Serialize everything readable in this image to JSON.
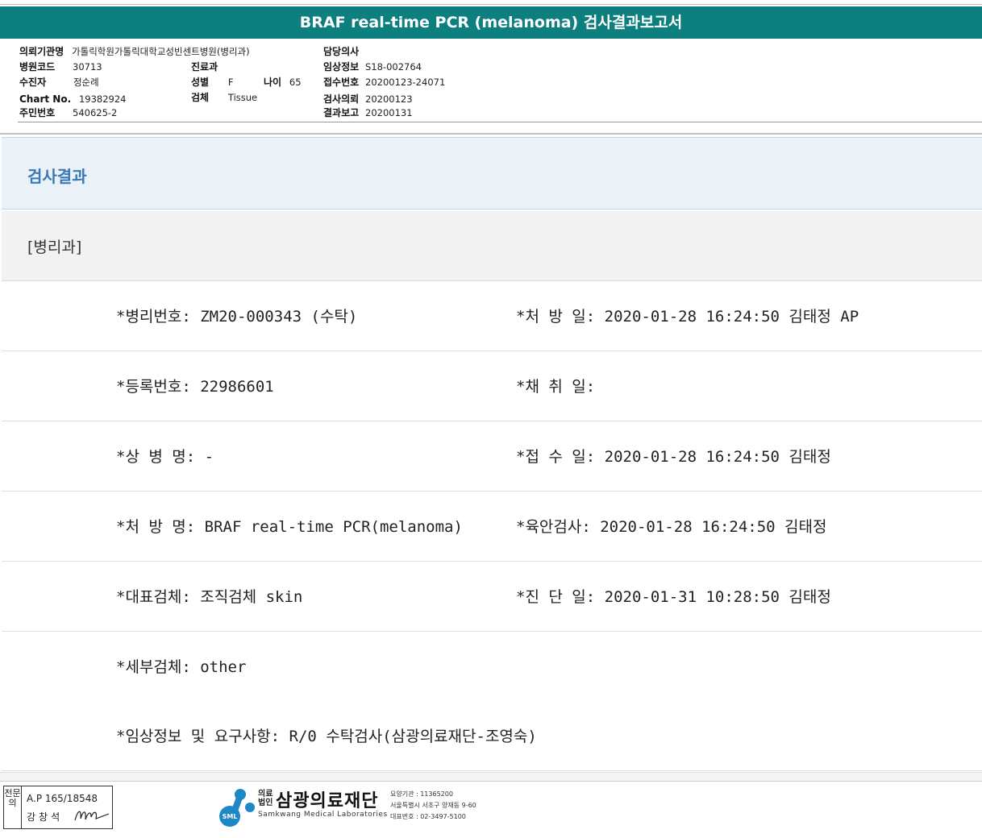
{
  "report": {
    "title": "BRAF real-time PCR (melanoma) 검사결과보고서"
  },
  "header": {
    "institution_label": "의뢰기관명",
    "institution_value": "가톨릭학원가톨릭대학교성빈센트병원(병리과)",
    "hospital_code_label": "병원코드",
    "hospital_code_value": "30713",
    "patient_label": "수진자",
    "patient_value": "정순례",
    "chart_label": "Chart No.",
    "chart_value": "19382924",
    "rrn_label": "주민번호",
    "rrn_value": "540625-2",
    "dept_label": "진료과",
    "dept_value": "",
    "sex_label": "성별",
    "sex_value": "F",
    "age_label": "나이",
    "age_value": "65",
    "specimen_label": "검체",
    "specimen_value": "Tissue",
    "doctor_label": "담당의사",
    "doctor_value": "",
    "clinical_label": "임상정보",
    "clinical_value": "S18-002764",
    "receipt_label": "접수번호",
    "receipt_value": "20200123-24071",
    "request_label": "검사의뢰",
    "request_value": "20200123",
    "report_label": "결과보고",
    "report_value": "20200131"
  },
  "results": {
    "section_title": "검사결과",
    "dept_tag": "[병리과]",
    "rows": [
      {
        "left": "*병리번호: ZM20-000343 (수탁)",
        "right": "*처 방 일: 2020-01-28 16:24:50  김태정 AP"
      },
      {
        "left": "*등록번호: 22986601",
        "right": "*채 취 일:"
      },
      {
        "left": "*상 병 명: -",
        "right": "*접 수 일: 2020-01-28 16:24:50  김태정"
      },
      {
        "left": "*처 방 명: BRAF real-time PCR(melanoma)",
        "right": "*육안검사: 2020-01-28 16:24:50  김태정"
      },
      {
        "left": "*대표검체: 조직검체 skin",
        "right": "*진 단 일: 2020-01-31 10:28:50  김태정"
      },
      {
        "left": "*세부검체: other",
        "right": ""
      },
      {
        "left": "*임상정보 및 요구사항: R/0 수탁검사(삼광의료재단-조영숙)",
        "right": ""
      }
    ]
  },
  "footer": {
    "stamp_side": "전문의",
    "stamp_ap": "A.P 165/18548",
    "stamp_name": "강창석",
    "logo_prefix": "의료\n법인",
    "logo_name": "삼광의료재단",
    "logo_eng": "Samkwang Medical Laboratories",
    "logo_badge": "SML",
    "logo_code": "요양기관 : 11365200",
    "logo_address": "서울특별시 서초구 양재동 9-60",
    "logo_phone": "대표번호 : 02-3497-5100"
  },
  "colors": {
    "title_bar": "#0e7f7f",
    "section_title": "#3b78b6",
    "logo_blue": "#1e88c7"
  }
}
